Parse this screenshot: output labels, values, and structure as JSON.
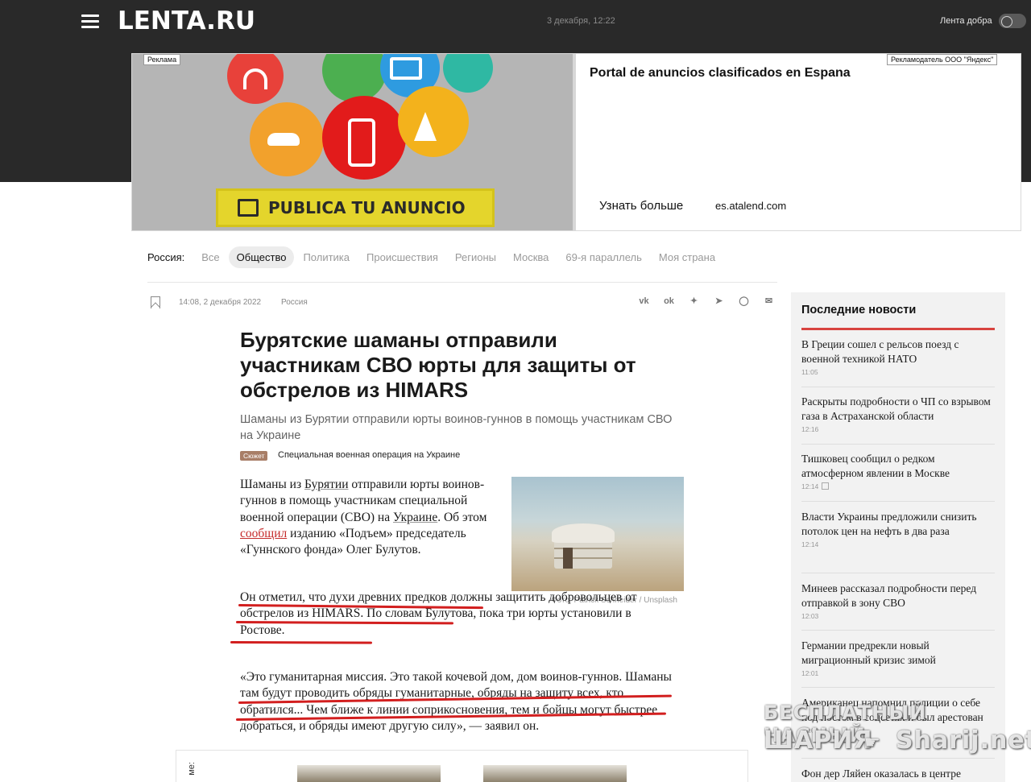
{
  "header": {
    "logo": "LENTA.RU",
    "datetime": "3 декабря, 12:22",
    "good_news_label": "Лента добра"
  },
  "ad": {
    "badge": "Реклама",
    "advertiser": "Рекламодатель ООО \"Яндекс\"",
    "title": "Portal de anuncios clasificados en Espana",
    "cta": "PUBLICA TU ANUNCIO",
    "more": "Узнать больше",
    "domain": "es.atalend.com"
  },
  "categories": {
    "label": "Россия:",
    "items": [
      "Все",
      "Общество",
      "Политика",
      "Происшествия",
      "Регионы",
      "Москва",
      "69-я параллель",
      "Моя страна"
    ],
    "active": "Общество"
  },
  "article": {
    "time": "14:08, 2 декабря 2022",
    "region": "Россия",
    "share_icons": [
      "vk-icon",
      "odnoklassniki-icon",
      "twitter-icon",
      "telegram-icon",
      "whatsapp-icon",
      "mail-icon"
    ],
    "title": "Бурятские шаманы отправили участникам СВО юрты для защиты от обстрелов из HIMARS",
    "subtitle": "Шаманы из Бурятии отправили юрты воинов-гуннов в помощь участникам СВО на Украине",
    "story_badge": "Сюжет",
    "story_link": "Специальная военная операция на Украине",
    "p1": {
      "a": "Шаманы из ",
      "b": "Бурятии",
      "c": " отправили юрты воинов-гуннов в помощь участникам специальной военной операции (СВО) на ",
      "d": "Украине",
      "e": ". Об этом ",
      "f": "сообщил",
      "g": " изданию «Подъем» председатель «Гуннского фонда» Олег Булутов."
    },
    "p2": "Он отметил, что духи древних предков должны защитить добровольцев от обстрелов из HIMARS. По словам Булутова, пока три юрты установили в Ростове.",
    "p3": "«Это гуманитарная миссия. Это такой кочевой дом, дом воинов-гуннов. Шаманы там будут проводить обряды гуманитарные, обряды на защиту всех, кто обратился... Чем ближе к линии соприкосновения, тем и бойцы могут быстрее добраться, и обряды имеют другую силу», — заявил он.",
    "photo_caption": "Фото: Patrick Schneider / Unsplash",
    "bottom_label": "ме:"
  },
  "sidebar": {
    "title": "Последние новости",
    "items": [
      {
        "text": "В Греции сошел с рельсов поезд с военной техникой НАТО",
        "time": "11:05"
      },
      {
        "text": "Раскрыты подробности о ЧП со взрывом газа в Астраханской области",
        "time": "12:16"
      },
      {
        "text": "Тишковец сообщил о редком атмосферном явлении в Москве",
        "time": "12:14"
      },
      {
        "text": "Власти Украины предложили снизить потолок цен на нефть в два раза",
        "time": "12:14"
      },
      {
        "text": "Минеев рассказал подробности перед отправкой в зону СВО",
        "time": "12:03"
      },
      {
        "text": "Германии предрекли новый миграционный кризис зимой",
        "time": "12:01"
      },
      {
        "text": "Американец напомнил полиции о себе под постом в соцсетях и был арестован",
        "time": "12:00"
      },
      {
        "text": "Фон дер Ляйен оказалась в центре",
        "time": ""
      }
    ]
  },
  "watermark": {
    "line1": "БЕСПЛАТНЫЙ ЧАСНЫЙ",
    "line2": "ШАРИЯ",
    "line3": "Sharij.net"
  }
}
